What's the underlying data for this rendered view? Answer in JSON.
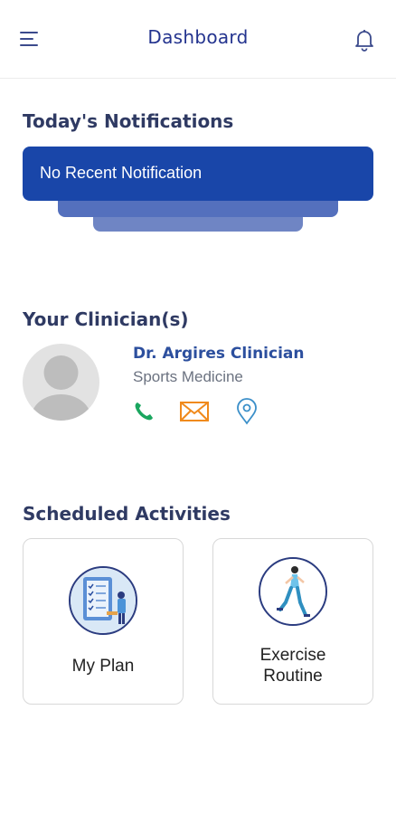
{
  "header": {
    "title": "Dashboard",
    "menu_icon": "hamburger-menu-icon",
    "bell_icon": "bell-icon"
  },
  "notifications": {
    "title": "Today's Notifications",
    "message": "No Recent Notification"
  },
  "clinicians": {
    "title": "Your Clinician(s)",
    "items": [
      {
        "name": "Dr. Argires Clinician",
        "specialty": "Sports Medicine"
      }
    ]
  },
  "activities": {
    "title": "Scheduled Activities",
    "items": [
      {
        "label": "My Plan"
      },
      {
        "label_line1": "Exercise",
        "label_line2": "Routine"
      }
    ]
  },
  "colors": {
    "brand": "#24348f",
    "notification_card": "#1946a9",
    "phone": "#1aa65f",
    "mail": "#f08a1c",
    "location": "#3b8fc9"
  }
}
